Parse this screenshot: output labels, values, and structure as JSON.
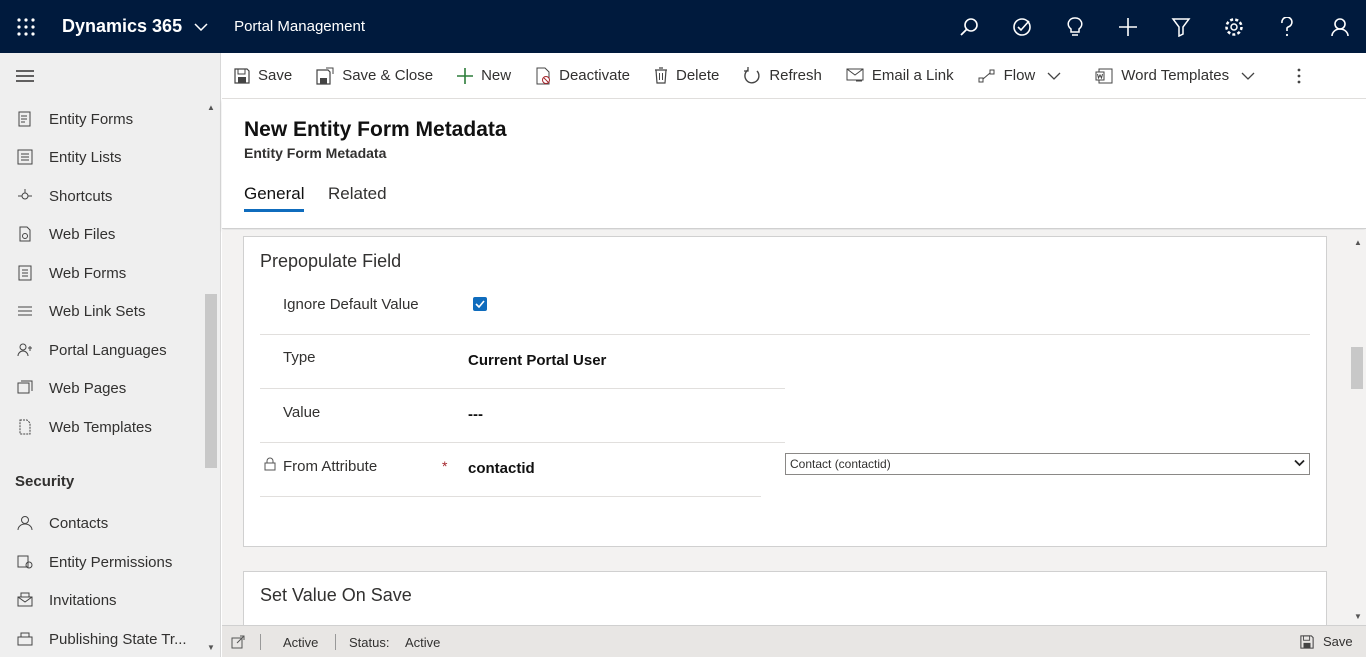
{
  "topbar": {
    "app_name": "Dynamics 365",
    "area_name": "Portal Management",
    "icons": [
      "search-icon",
      "task-icon",
      "lightbulb-icon",
      "plus-icon",
      "filter-icon",
      "settings-icon",
      "help-icon",
      "user-icon"
    ]
  },
  "sidebar": {
    "items": [
      {
        "label": "Entity Forms",
        "icon": "form-icon"
      },
      {
        "label": "Entity Lists",
        "icon": "list-icon"
      },
      {
        "label": "Shortcuts",
        "icon": "shortcut-icon"
      },
      {
        "label": "Web Files",
        "icon": "file-icon"
      },
      {
        "label": "Web Forms",
        "icon": "webform-icon"
      },
      {
        "label": "Web Link Sets",
        "icon": "linkset-icon"
      },
      {
        "label": "Portal Languages",
        "icon": "language-icon"
      },
      {
        "label": "Web Pages",
        "icon": "pages-icon"
      },
      {
        "label": "Web Templates",
        "icon": "template-icon"
      }
    ],
    "group_security": "Security",
    "security_items": [
      {
        "label": "Contacts",
        "icon": "person-icon"
      },
      {
        "label": "Entity Permissions",
        "icon": "permissions-icon"
      },
      {
        "label": "Invitations",
        "icon": "invitation-icon"
      },
      {
        "label": "Publishing State Tr...",
        "icon": "publishing-icon"
      }
    ]
  },
  "commands": {
    "save": "Save",
    "save_close": "Save & Close",
    "new": "New",
    "deactivate": "Deactivate",
    "delete": "Delete",
    "refresh": "Refresh",
    "email_link": "Email a Link",
    "flow": "Flow",
    "word_templates": "Word Templates"
  },
  "header": {
    "title": "New Entity Form Metadata",
    "entity": "Entity Form Metadata",
    "tabs": [
      "General",
      "Related"
    ]
  },
  "prepopulate": {
    "title": "Prepopulate Field",
    "ignore_default_label": "Ignore Default Value",
    "ignore_default_checked": true,
    "type_label": "Type",
    "type_value": "Current Portal User",
    "value_label": "Value",
    "value_value": "---",
    "from_attr_label": "From Attribute",
    "required_mark": "*",
    "from_attr_value": "contactid",
    "from_attr_select": "Contact (contactid)"
  },
  "set_value": {
    "title": "Set Value On Save"
  },
  "statusbar": {
    "state": "Active",
    "status_label": "Status:",
    "status_value": "Active",
    "save_label": "Save"
  },
  "colors": {
    "topbar_bg": "#001a3d",
    "accent": "#0f6cbd",
    "required": "#a4262c"
  }
}
